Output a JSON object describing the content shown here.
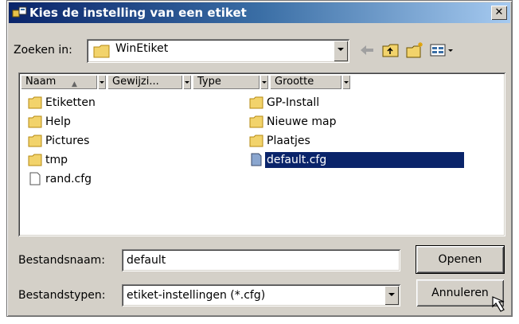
{
  "window": {
    "title": "Kies de instelling van een etiket",
    "close_label": "✕"
  },
  "lookin": {
    "label": "Zoeken in:",
    "value": "WinEtiket"
  },
  "columns": [
    {
      "label": "Naam"
    },
    {
      "label": "Gewijzi..."
    },
    {
      "label": "Type"
    },
    {
      "label": "Grootte"
    }
  ],
  "files": [
    {
      "name": "Etiketten",
      "icon": "folder-icon"
    },
    {
      "name": "Help",
      "icon": "folder-icon"
    },
    {
      "name": "Pictures",
      "icon": "folder-icon"
    },
    {
      "name": "tmp",
      "icon": "folder-icon"
    },
    {
      "name": "rand.cfg",
      "icon": "file-icon"
    },
    {
      "name": "GP-Install",
      "icon": "folder-icon"
    },
    {
      "name": "Nieuwe map",
      "icon": "folder-icon"
    },
    {
      "name": "Plaatjes",
      "icon": "folder-icon"
    },
    {
      "name": "default.cfg",
      "icon": "cfg-file-icon",
      "selected": true
    }
  ],
  "filename": {
    "label": "Bestandsnaam:",
    "value": "default"
  },
  "filetype": {
    "label": "Bestandstypen:",
    "value": "etiket-instellingen (*.cfg)"
  },
  "buttons": {
    "open": "Openen",
    "cancel": "Annuleren"
  },
  "colors": {
    "title_start": "#0a246a",
    "title_end": "#a6caf0",
    "selection": "#0a246a",
    "dialog_bg": "#d4d0c8"
  }
}
